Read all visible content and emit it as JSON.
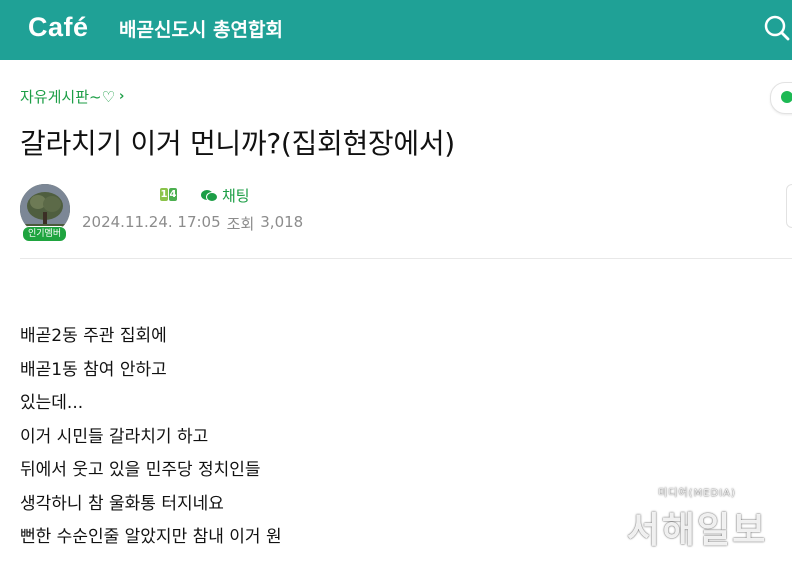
{
  "header": {
    "logo": "Café",
    "cafe_name": "배곧신도시 총연합회",
    "search_icon": "search-icon"
  },
  "post": {
    "board_link": "자유게시판~♡",
    "board_chevron": "›",
    "title": "갈라치기 이거 먼니까?(집회현장에서)",
    "author": {
      "badge": "인기멤버",
      "level_badge": "14",
      "chat_label": "채팅"
    },
    "meta": {
      "date": "2024.11.24. 17:05",
      "views_label": "조회",
      "views": "3,018"
    },
    "body_lines": [
      "배곧2동 주관 집회에",
      "배곧1동 참여 안하고",
      "있는데...",
      "이거 시민들 갈라치기 하고",
      "뒤에서 웃고 있을 민주당 정치인들",
      "생각하니 참 울화통 터지네요",
      "뻔한 수순인줄 알았지만 참내 이거 원"
    ]
  },
  "watermark": {
    "sub": "미디어(MEDIA)",
    "main": "서해일보"
  },
  "colors": {
    "header_bg": "#1fa196",
    "accent_green": "#1c9e46"
  }
}
